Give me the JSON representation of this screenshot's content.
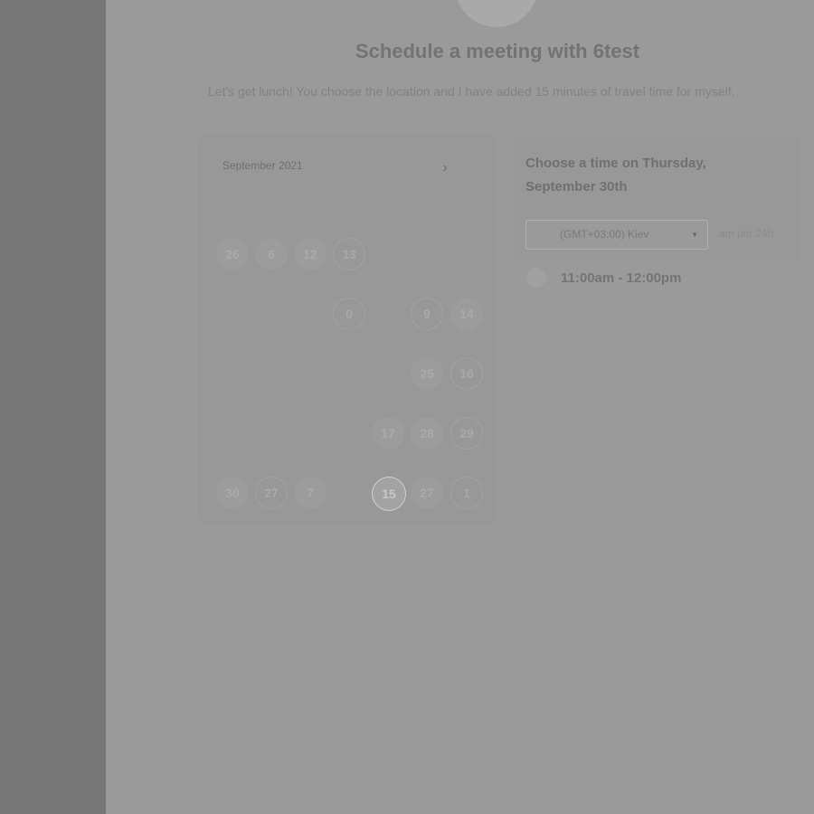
{
  "meeting": {
    "title": "Schedule a meeting with 6test",
    "description": "Let's get lunch! You choose the location and I have added 15 minutes of travel time for myself."
  },
  "calendar": {
    "month_label": "September 2021",
    "next_icon": "chevron-right-icon",
    "days": [
      {
        "label": "26",
        "state": "unavailable"
      },
      {
        "label": "6",
        "state": "unavailable"
      },
      {
        "label": "12",
        "state": "unavailable"
      },
      {
        "label": "13",
        "state": "available"
      },
      {
        "label": "0",
        "state": "available"
      },
      {
        "label": "9",
        "state": "available"
      },
      {
        "label": "14",
        "state": "unavailable"
      },
      {
        "label": "25",
        "state": "unavailable"
      },
      {
        "label": "16",
        "state": "available"
      },
      {
        "label": "17",
        "state": "unavailable"
      },
      {
        "label": "28",
        "state": "unavailable"
      },
      {
        "label": "29",
        "state": "available"
      },
      {
        "label": "30",
        "state": "unavailable"
      },
      {
        "label": "27",
        "state": "available"
      },
      {
        "label": "7",
        "state": "unavailable"
      },
      {
        "label": "15",
        "state": "selected"
      },
      {
        "label": "27",
        "state": "unavailable"
      },
      {
        "label": "1",
        "state": "available"
      }
    ]
  },
  "times": {
    "heading": "Choose a time on Thursday, September 30th",
    "timezone": "(GMT+03:00) Kiev",
    "format_toggle": "am pm 24h",
    "slots": [
      "11:00am - 12:00pm"
    ]
  }
}
